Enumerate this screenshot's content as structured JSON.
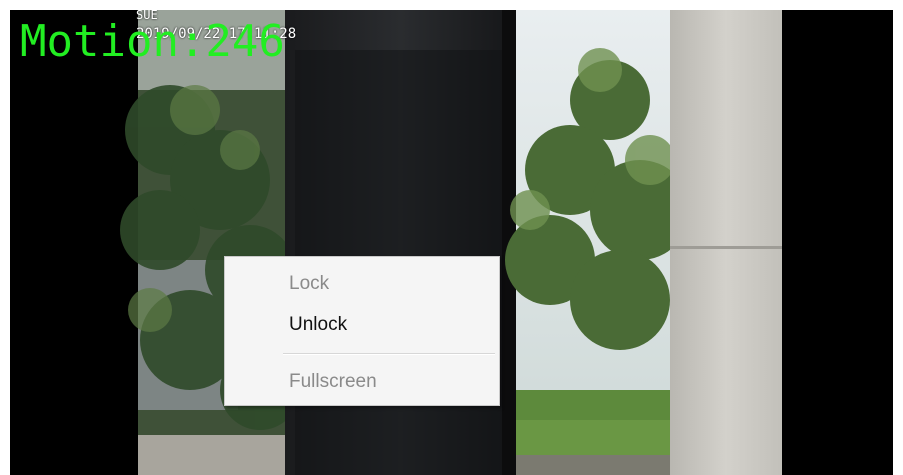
{
  "osd": {
    "title": "SUE",
    "timestamp": "2019/09/22 17:11:28",
    "motion_label": "Motion:246"
  },
  "context_menu": {
    "items": [
      {
        "label": "Lock",
        "enabled": false
      },
      {
        "label": "Unlock",
        "enabled": true
      },
      {
        "label": "Fullscreen",
        "enabled": false
      }
    ]
  },
  "colors": {
    "motion_text": "#22ee22",
    "menu_background": "#f5f5f5",
    "menu_disabled_text": "#8a8a8a",
    "menu_enabled_text": "#111111"
  }
}
